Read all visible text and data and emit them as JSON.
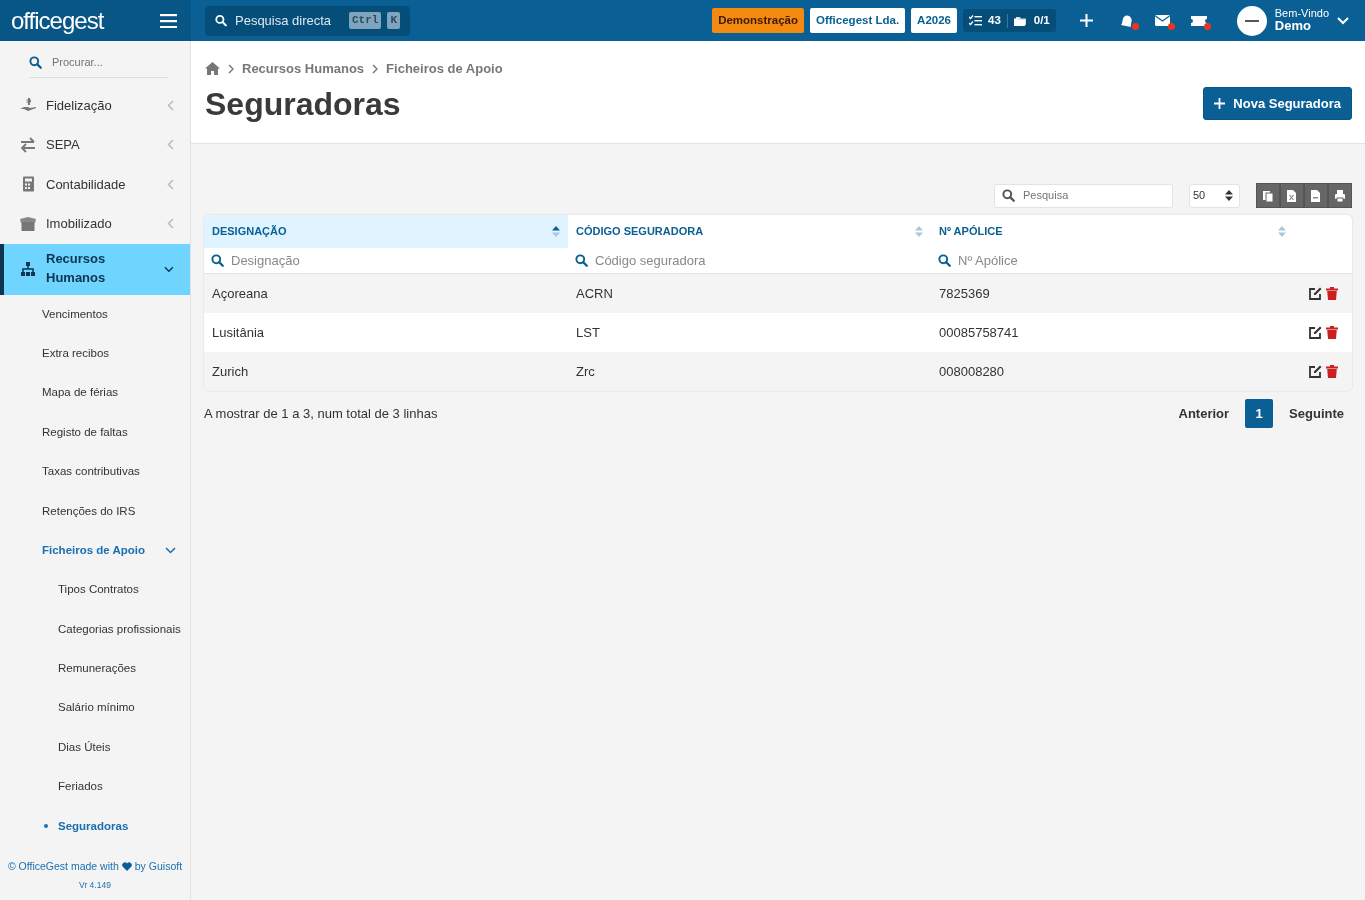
{
  "topbar": {
    "logo": "officegest",
    "search": {
      "placeholder": "Pesquisa directa",
      "keys": [
        "Ctrl",
        "K"
      ]
    },
    "badges": [
      {
        "kind": "demo",
        "label": "Demonstração"
      },
      {
        "kind": "light",
        "label": "Officegest Lda."
      },
      {
        "kind": "light",
        "label": "A2026"
      }
    ],
    "counters": [
      {
        "kind": "tasks",
        "label": "43"
      },
      {
        "kind": "folders",
        "label": "0/1"
      }
    ],
    "notifications": [
      {
        "kind": "bell",
        "unread": true
      },
      {
        "kind": "mail",
        "unread": true
      },
      {
        "kind": "ticket",
        "unread": true
      }
    ],
    "user": {
      "greeting": "Bem-Vindo",
      "name": "Demo"
    }
  },
  "sidebar": {
    "search": {
      "placeholder": "Procurar..."
    },
    "items": [
      {
        "label": "Fidelização",
        "selected": false,
        "expanded": false
      },
      {
        "label": "SEPA",
        "selected": false,
        "expanded": false
      },
      {
        "label": "Contabilidade",
        "selected": false,
        "expanded": false
      },
      {
        "label": "Imobilizado",
        "selected": false,
        "expanded": false
      },
      {
        "label": "Recursos Humanos",
        "selected": true,
        "expanded": true,
        "children": [
          {
            "label": "Vencimentos",
            "selected": false
          },
          {
            "label": "Extra recibos",
            "selected": false
          },
          {
            "label": "Mapa de férias",
            "selected": false
          },
          {
            "label": "Registo de faltas",
            "selected": false
          },
          {
            "label": "Taxas contributivas",
            "selected": false
          },
          {
            "label": "Retenções do IRS",
            "selected": false
          },
          {
            "label": "Ficheiros de Apoio",
            "selected": true,
            "expanded": true,
            "children": [
              {
                "label": "Tipos Contratos",
                "selected": false
              },
              {
                "label": "Categorias profissionais",
                "selected": false
              },
              {
                "label": "Remunerações",
                "selected": false
              },
              {
                "label": "Salário mínimo",
                "selected": false
              },
              {
                "label": "Dias Úteis",
                "selected": false
              },
              {
                "label": "Feriados",
                "selected": false
              },
              {
                "label": "Seguradoras",
                "selected": true
              }
            ]
          }
        ]
      }
    ],
    "footer": {
      "credit_before": "© OfficeGest made with",
      "credit_after": "by Guisoft",
      "version": "Vr 4.149"
    }
  },
  "breadcrumb": [
    "Recursos Humanos",
    "Ficheiros de Apoio"
  ],
  "page_title": "Seguradoras",
  "new_button": "Nova Seguradora",
  "table": {
    "search": {
      "placeholder": "Pesquisa"
    },
    "page_size": "50",
    "columns": [
      {
        "label": "DESIGNAÇÃO",
        "sorted": true,
        "filter_placeholder": "Designação"
      },
      {
        "label": "CÓDIGO SEGURADORA",
        "sorted": false,
        "filter_placeholder": "Código seguradora"
      },
      {
        "label": "Nº APÓLICE",
        "sorted": false,
        "filter_placeholder": "Nº Apólice"
      }
    ],
    "rows": [
      [
        "Açoreana",
        "ACRN",
        "7825369"
      ],
      [
        "Lusitânia",
        "LST",
        "00085758741"
      ],
      [
        "Zurich",
        "Zrc",
        "008008280"
      ]
    ],
    "info": "A mostrar de 1 a 3, num total de 3 linhas",
    "pagination": {
      "previous": "Anterior",
      "pages": [
        {
          "label": "1",
          "selected": true
        }
      ],
      "next": "Seguinte"
    }
  }
}
